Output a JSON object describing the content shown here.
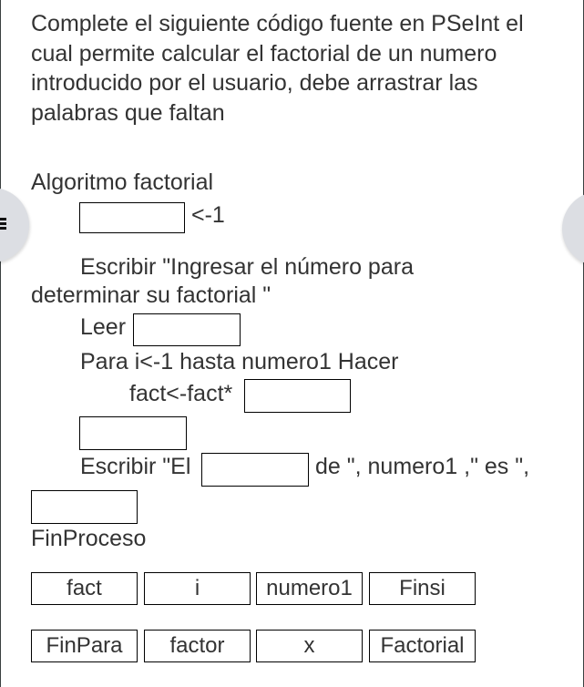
{
  "instructions": "Complete el siguiente código fuente en PSeInt el cual permite calcular el factorial de un numero introducido por el usuario, debe arrastrar las palabras que faltan",
  "code": {
    "line1": "Algoritmo factorial",
    "line2_suffix": "<-1",
    "line3a": "Escribir \"Ingresar el número para",
    "line3b": "determinar su factorial \"",
    "line4_prefix": "Leer",
    "line5": "Para i<-1 hasta numero1 Hacer",
    "line6_prefix": "fact<-fact*",
    "line8_prefix": "Escribir \"El",
    "line8_suffix": "de \", numero1 ,\" es \",",
    "line10": "FinProceso"
  },
  "blanks": [
    "",
    "",
    "",
    "",
    "",
    ""
  ],
  "word_bank": [
    [
      "fact",
      "i",
      "numero1",
      "Finsi"
    ],
    [
      "FinPara",
      "factor",
      "x",
      "Factorial"
    ]
  ],
  "controls": {
    "left_button_icon": "menu-icon",
    "right_button_icon": "nav-button"
  }
}
